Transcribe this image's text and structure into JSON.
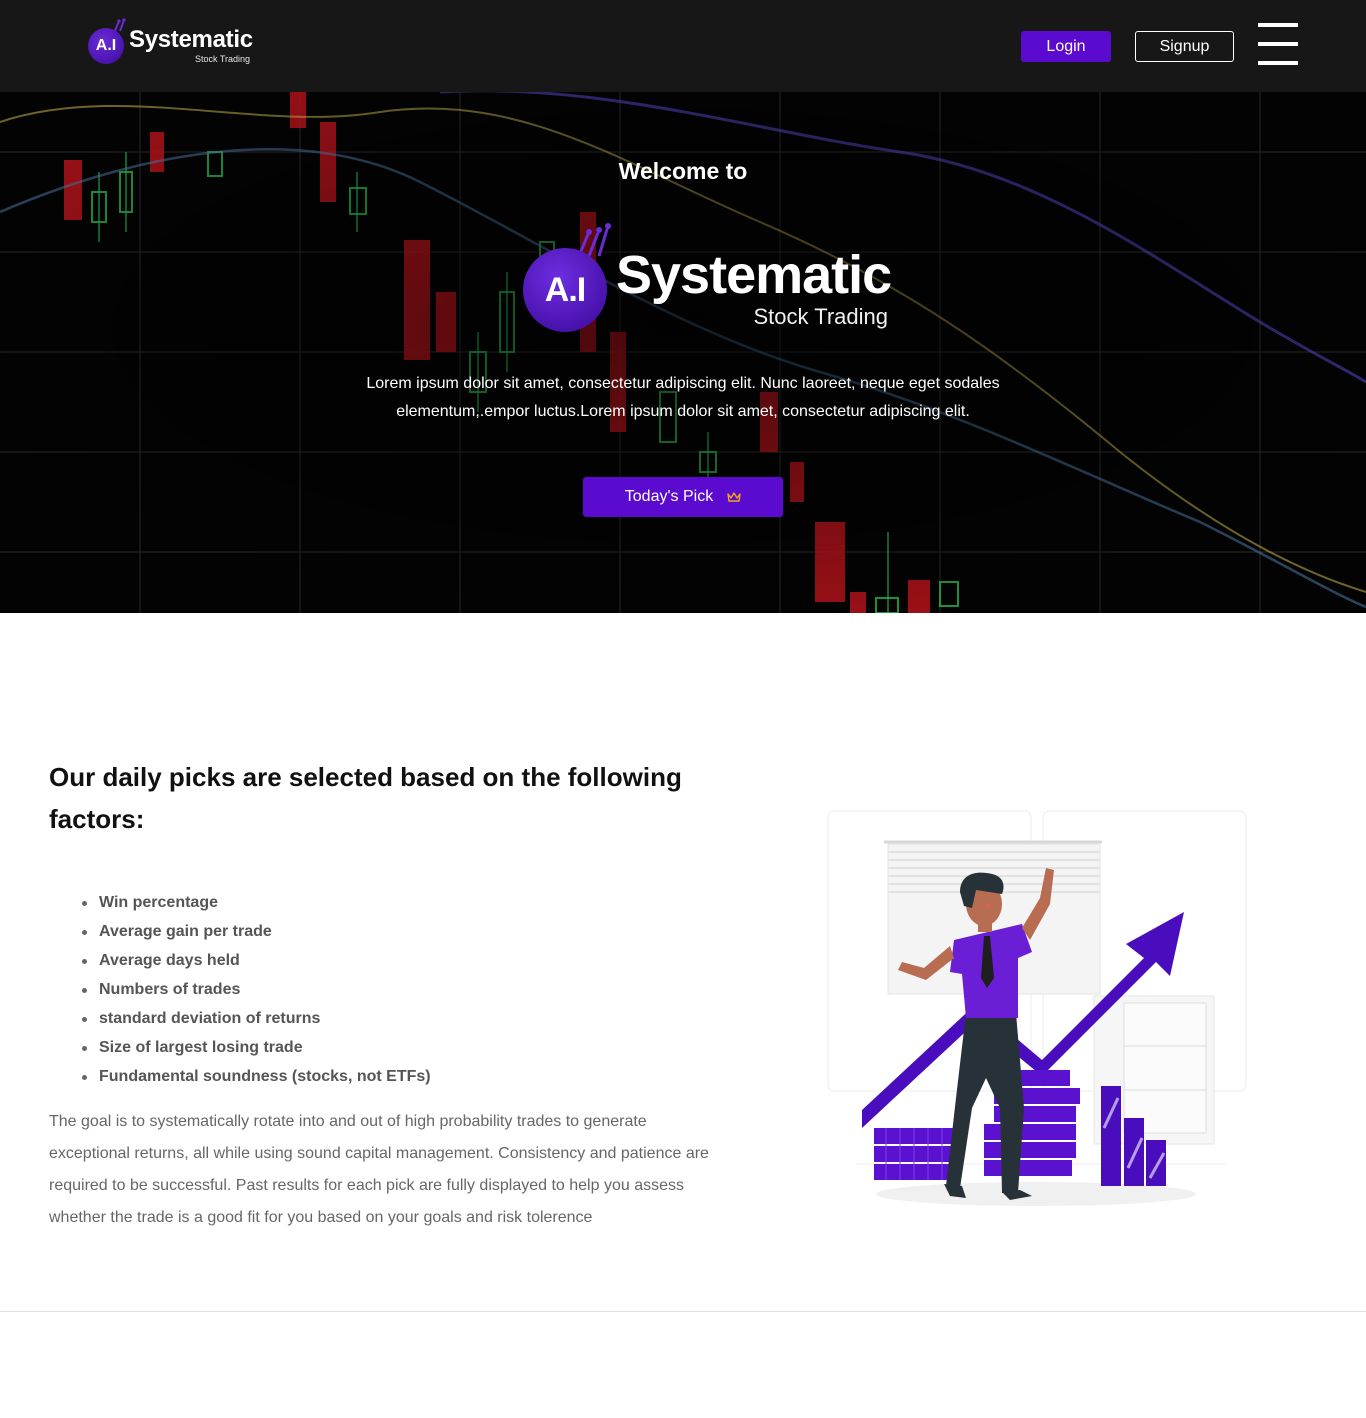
{
  "header": {
    "brand": {
      "badge": "A.I",
      "name": "Systematic",
      "tagline": "Stock Trading"
    },
    "login_label": "Login",
    "signup_label": "Signup",
    "menu_icon": "hamburger-icon"
  },
  "hero": {
    "welcome": "Welcome to",
    "brand": {
      "badge": "A.I",
      "name": "Systematic",
      "tagline": "Stock Trading"
    },
    "description_line1": "Lorem ipsum dolor sit amet, consectetur adipiscing elit. Nunc laoreet, neque eget sodales",
    "description_line2": "elementum,.empor luctus.Lorem ipsum dolor sit amet, consectetur adipiscing elit.",
    "cta_label": "Today's Pick",
    "cta_icon": "crown-icon"
  },
  "factors": {
    "title": "Our daily picks are selected based on the following factors:",
    "items": [
      "Win percentage",
      "Average gain per trade",
      "Average days held",
      "Numbers of trades",
      "standard deviation of returns",
      "Size of largest losing trade",
      "Fundamental soundness (stocks, not ETFs)"
    ],
    "goal": "The goal is to systematically rotate into and out of high probability trades to generate exceptional returns, all while using sound capital management. Consistency and patience are required to be successful. Past results for each pick are fully displayed to help you assess whether the trade is a good fit for you based on your goals and risk tolerence"
  },
  "colors": {
    "brand_purple": "#5b0bcf",
    "header_bg": "#171717",
    "hero_bg": "#030303",
    "candle_red": "#c8161d",
    "candle_green": "#1fa34a"
  }
}
